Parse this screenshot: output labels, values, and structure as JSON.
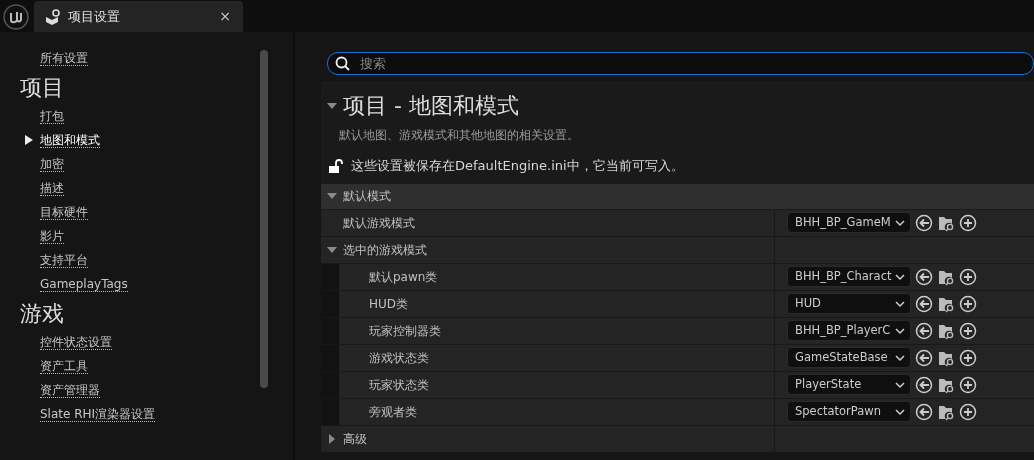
{
  "tab": {
    "title": "项目设置",
    "close": "×"
  },
  "sidebar": {
    "items": [
      {
        "kind": "link",
        "label": "所有设置",
        "selected": false
      },
      {
        "kind": "heading",
        "label": "项目"
      },
      {
        "kind": "link",
        "label": "打包",
        "selected": false
      },
      {
        "kind": "link",
        "label": "地图和模式",
        "selected": true
      },
      {
        "kind": "link",
        "label": "加密",
        "selected": false
      },
      {
        "kind": "link",
        "label": "描述",
        "selected": false
      },
      {
        "kind": "link",
        "label": "目标硬件",
        "selected": false
      },
      {
        "kind": "link",
        "label": "影片",
        "selected": false
      },
      {
        "kind": "link",
        "label": "支持平台",
        "selected": false
      },
      {
        "kind": "link",
        "label": "GameplayTags",
        "selected": false
      },
      {
        "kind": "heading",
        "label": "游戏"
      },
      {
        "kind": "link",
        "label": "控件状态设置",
        "selected": false
      },
      {
        "kind": "link",
        "label": "资产工具",
        "selected": false
      },
      {
        "kind": "link",
        "label": "资产管理器",
        "selected": false
      },
      {
        "kind": "link",
        "label": "Slate RHI渲染器设置",
        "selected": false
      }
    ]
  },
  "search": {
    "placeholder": "搜索"
  },
  "section": {
    "title": "项目 - 地图和模式",
    "expanded": true,
    "description": "默认地图、游戏模式和其他地图的相关设置。",
    "notice": "这些设置被保存在DefaultEngine.ini中，它当前可写入。"
  },
  "categories": [
    {
      "title": "默认模式",
      "expanded": true,
      "children": [
        {
          "kind": "property",
          "label": "默认游戏模式",
          "value": "BHH_BP_GameM"
        },
        {
          "kind": "group",
          "label": "选中的游戏模式",
          "expanded": true,
          "children": [
            {
              "kind": "property",
              "label": "默认pawn类",
              "value": "BHH_BP_Charact"
            },
            {
              "kind": "property",
              "label": "HUD类",
              "value": "HUD"
            },
            {
              "kind": "property",
              "label": "玩家控制器类",
              "value": "BHH_BP_PlayerC"
            },
            {
              "kind": "property",
              "label": "游戏状态类",
              "value": "GameStateBase"
            },
            {
              "kind": "property",
              "label": "玩家状态类",
              "value": "PlayerState"
            },
            {
              "kind": "property",
              "label": "旁观者类",
              "value": "SpectatorPawn"
            }
          ]
        },
        {
          "kind": "group",
          "label": "高级",
          "expanded": false
        }
      ]
    }
  ]
}
